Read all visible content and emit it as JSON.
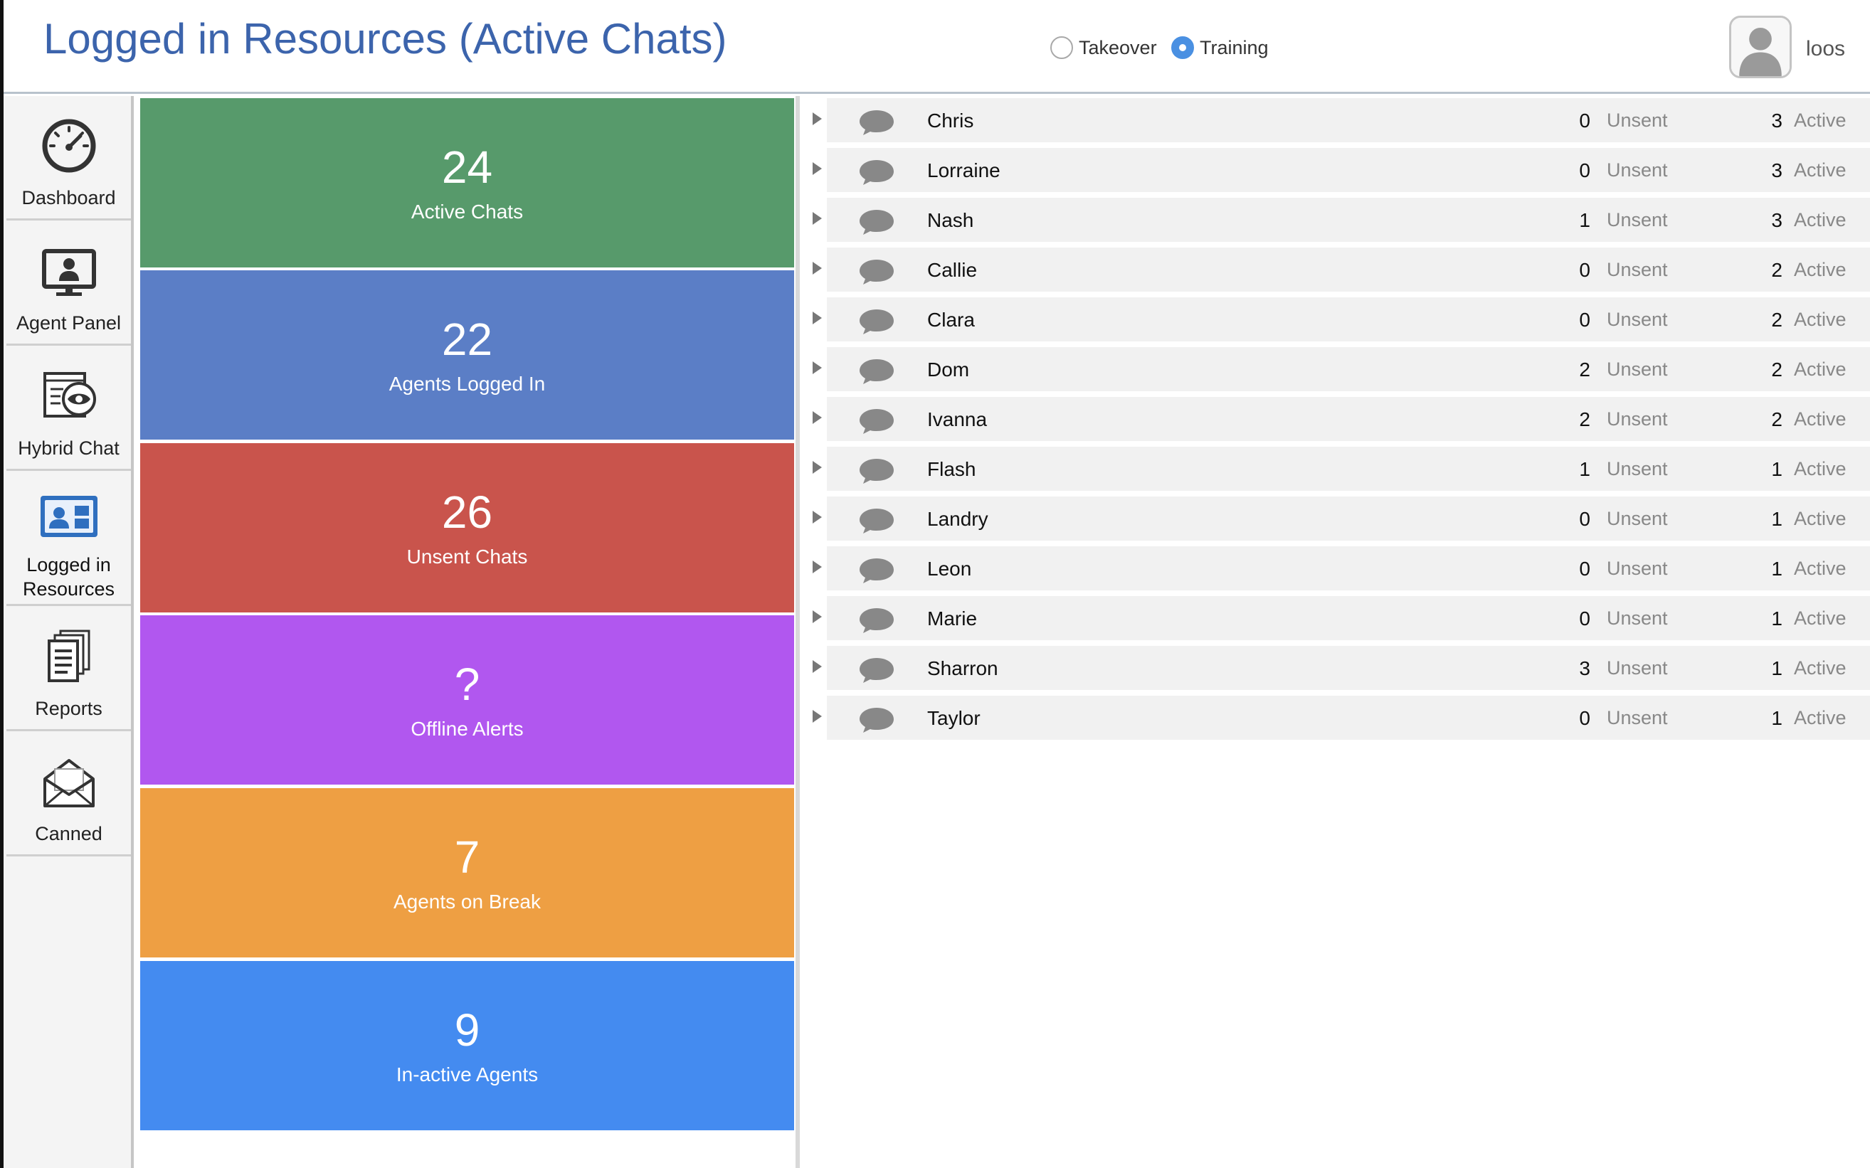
{
  "header": {
    "title": "Logged in Resources (Active Chats)",
    "modes": [
      {
        "label": "Takeover",
        "selected": false
      },
      {
        "label": "Training",
        "selected": true
      }
    ],
    "username": "loos"
  },
  "sidebar": {
    "items": [
      {
        "label": "Dashboard",
        "icon": "speedometer-icon"
      },
      {
        "label": "Agent Panel",
        "icon": "monitor-agent-icon"
      },
      {
        "label": "Hybrid Chat",
        "icon": "window-eye-icon"
      },
      {
        "label": "Logged in Resources",
        "icon": "id-card-icon",
        "active": true
      },
      {
        "label": "Reports",
        "icon": "documents-icon"
      },
      {
        "label": "Canned",
        "icon": "envelope-icon"
      }
    ]
  },
  "tiles": [
    {
      "value": "24",
      "label": "Active Chats",
      "color": "#579a6b"
    },
    {
      "value": "22",
      "label": "Agents Logged In",
      "color": "#5b7ec6"
    },
    {
      "value": "26",
      "label": "Unsent Chats",
      "color": "#c9544c"
    },
    {
      "value": "?",
      "label": "Offline Alerts",
      "color": "#b157ef"
    },
    {
      "value": "7",
      "label": "Agents on Break",
      "color": "#ee9f43"
    },
    {
      "value": "9",
      "label": "In-active Agents",
      "color": "#448bf0"
    }
  ],
  "agents": {
    "unsent_label": "Unsent",
    "active_label": "Active",
    "rows": [
      {
        "name": "Chris",
        "unsent": "0",
        "active": "3"
      },
      {
        "name": "Lorraine",
        "unsent": "0",
        "active": "3"
      },
      {
        "name": "Nash",
        "unsent": "1",
        "active": "3"
      },
      {
        "name": "Callie",
        "unsent": "0",
        "active": "2"
      },
      {
        "name": "Clara",
        "unsent": "0",
        "active": "2"
      },
      {
        "name": "Dom",
        "unsent": "2",
        "active": "2"
      },
      {
        "name": "Ivanna",
        "unsent": "2",
        "active": "2"
      },
      {
        "name": "Flash",
        "unsent": "1",
        "active": "1"
      },
      {
        "name": "Landry",
        "unsent": "0",
        "active": "1"
      },
      {
        "name": "Leon",
        "unsent": "0",
        "active": "1"
      },
      {
        "name": "Marie",
        "unsent": "0",
        "active": "1"
      },
      {
        "name": "Sharron",
        "unsent": "3",
        "active": "1"
      },
      {
        "name": "Taylor",
        "unsent": "0",
        "active": "1"
      }
    ]
  }
}
